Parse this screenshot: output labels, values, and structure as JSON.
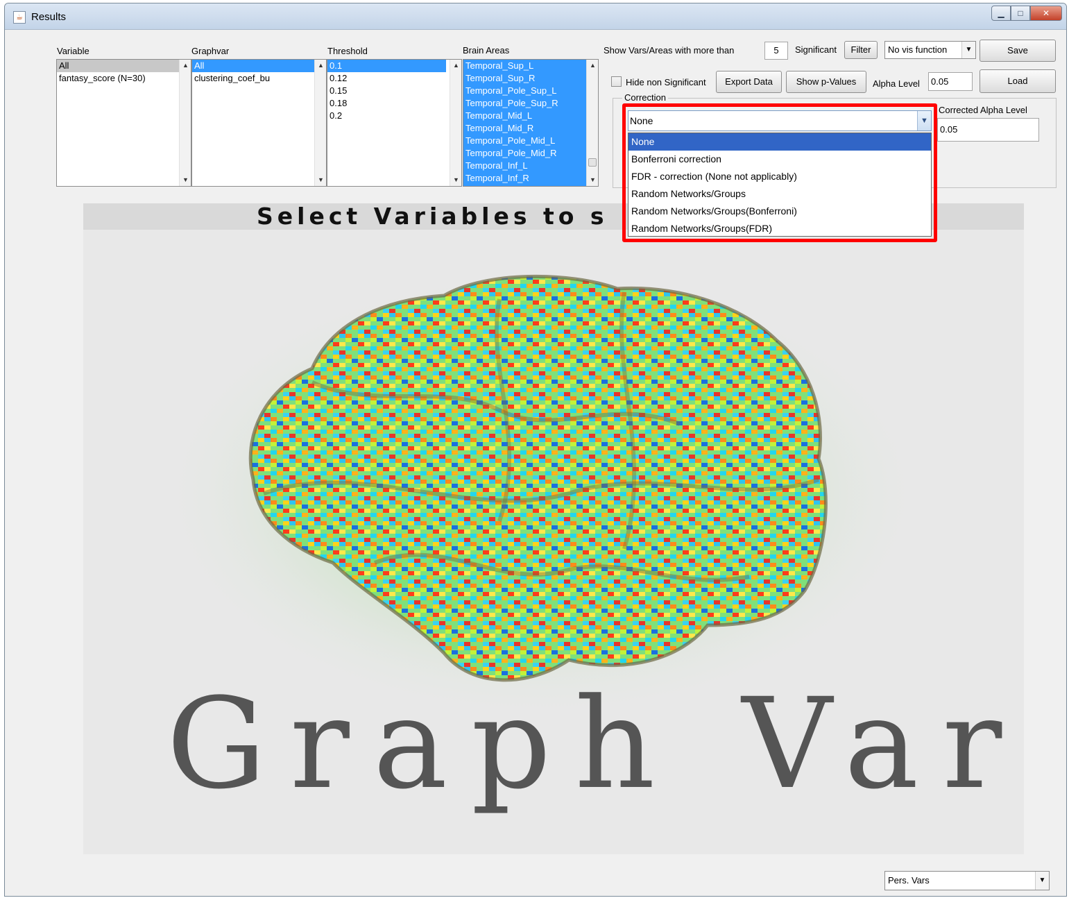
{
  "window": {
    "title": "Results"
  },
  "lists": {
    "variable": {
      "label": "Variable",
      "items": [
        "All",
        "fantasy_score (N=30)"
      ]
    },
    "graphvar": {
      "label": "Graphvar",
      "items": [
        "All",
        "clustering_coef_bu"
      ]
    },
    "threshold": {
      "label": "Threshold",
      "items": [
        "0.1",
        "0.12",
        "0.15",
        "0.18",
        "0.2"
      ]
    },
    "brain_areas": {
      "label": "Brain Areas",
      "items": [
        "Temporal_Sup_L",
        "Temporal_Sup_R",
        "Temporal_Pole_Sup_L",
        "Temporal_Pole_Sup_R",
        "Temporal_Mid_L",
        "Temporal_Mid_R",
        "Temporal_Pole_Mid_L",
        "Temporal_Pole_Mid_R",
        "Temporal_Inf_L",
        "Temporal_Inf_R"
      ]
    }
  },
  "controls": {
    "show_vars_label": "Show Vars/Areas with more than",
    "show_vars_value": "5",
    "significant_label": "Significant",
    "filter_button": "Filter",
    "vis_function": "No vis function",
    "save_button": "Save",
    "hide_non_significant": "Hide non Significant",
    "hide_non_significant_checked": false,
    "export_button": "Export Data",
    "show_pvalues_button": "Show p-Values",
    "alpha_label": "Alpha Level",
    "alpha_value": "0.05",
    "load_button": "Load"
  },
  "correction": {
    "group_label": "Correction",
    "selected": "None",
    "options": [
      "None",
      "Bonferroni correction",
      "FDR - correction (None not applicably)",
      "Random Networks/Groups",
      "Random Networks/Groups(Bonferroni)",
      "Random Networks/Groups(FDR)"
    ],
    "corrected_alpha_label": "Corrected Alpha Level",
    "corrected_alpha_value": "0.05"
  },
  "panel": {
    "banner": "Select Variables to s",
    "logo": "Graph Var"
  },
  "footer": {
    "pers_vars": "Pers. Vars"
  }
}
